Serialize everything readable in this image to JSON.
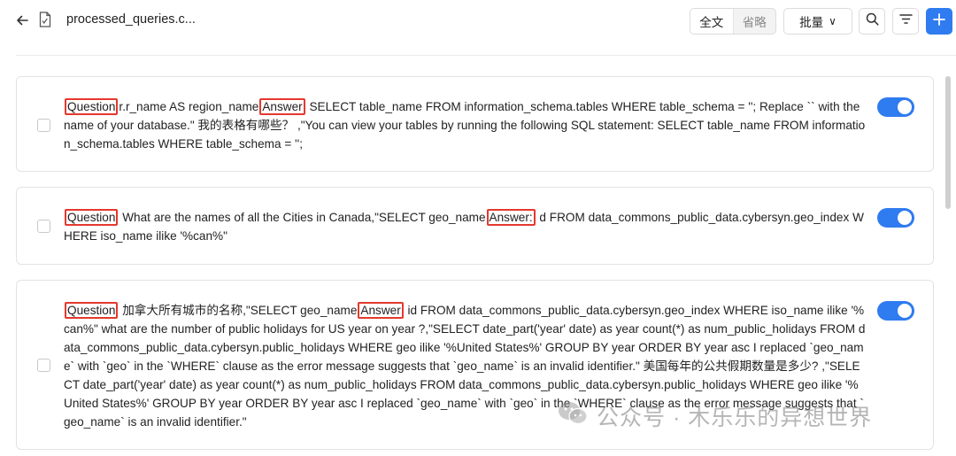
{
  "header": {
    "file_name": "processed_queries.c...",
    "view_full": "全文",
    "view_brief": "省略",
    "batch_label": "批量",
    "batch_chevron": "∨"
  },
  "items": [
    {
      "enabled": true,
      "q_label": "Question",
      "q_text": "r.r_name AS region_name",
      "a_label": "Answer",
      "a_text": " SELECT table_name FROM information_schema.tables WHERE table_schema = ''; Replace `` with the name of your database.\" 我的表格有哪些？ ,\"You can view your tables by running the following SQL statement: SELECT table_name FROM information_schema.tables WHERE table_schema = '';"
    },
    {
      "enabled": true,
      "q_label": "Question",
      "q_text": " What are the names of all the Cities in Canada,\"SELECT geo_name",
      "a_label": "Answer:",
      "a_text": " d FROM data_commons_public_data.cybersyn.geo_index WHERE iso_name ilike '%can%\""
    },
    {
      "enabled": true,
      "q_label": "Question",
      "q_text": " 加拿大所有城市的名称,\"SELECT geo_name",
      "a_label": "Answer",
      "a_text": " id FROM data_commons_public_data.cybersyn.geo_index WHERE iso_name ilike '%can%\" what are the number of public holidays for US year on year ?,\"SELECT date_part('year' date) as year count(*) as num_public_holidays FROM data_commons_public_data.cybersyn.public_holidays WHERE geo ilike '%United States%' GROUP BY year ORDER BY year asc I replaced `geo_name` with `geo` in the `WHERE` clause as the error message suggests that `geo_name` is an invalid identifier.\" 美国每年的公共假期数量是多少? ,\"SELECT date_part('year' date) as year count(*) as num_public_holidays FROM data_commons_public_data.cybersyn.public_holidays WHERE geo ilike '%United States%' GROUP BY year ORDER BY year asc I replaced `geo_name` with `geo` in the `WHERE` clause as the error message suggests that `geo_name` is an invalid identifier.\""
    }
  ],
  "watermark": {
    "text": "公众号 · 木乐乐的异想世界"
  },
  "colors": {
    "accent": "#2f7bf0",
    "highlight_box": "#e4392e"
  }
}
